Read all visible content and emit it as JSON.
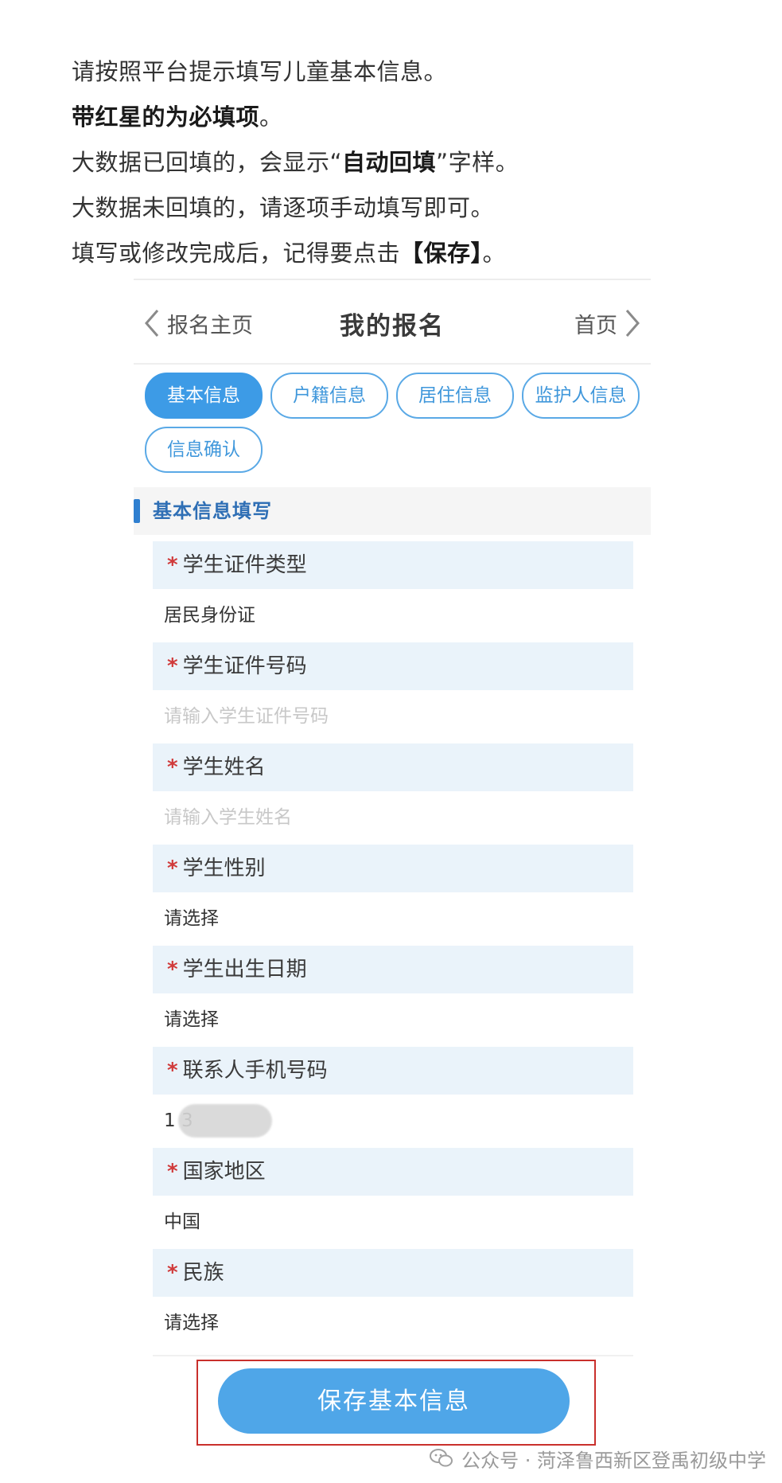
{
  "intro": {
    "line1": "请按照平台提示填写儿童基本信息。",
    "line2_bold": "带红星的为必填项",
    "line2_end": "。",
    "line3_start": "大数据已回填的，会显示“",
    "line3_bold": "自动回填",
    "line3_end": "”字样。",
    "line4": "大数据未回填的，请逐项手动填写即可。",
    "line5_start": "填写或修改完成后，记得要点击",
    "line5_bold": "【保存】",
    "line5_end": "。"
  },
  "nav": {
    "back_label": "报名主页",
    "title": "我的报名",
    "home_label": "首页"
  },
  "tabs": [
    {
      "label": "基本信息",
      "active": true
    },
    {
      "label": "户籍信息",
      "active": false
    },
    {
      "label": "居住信息",
      "active": false
    },
    {
      "label": "监护人信息",
      "active": false
    },
    {
      "label": "信息确认",
      "active": false
    }
  ],
  "section": {
    "title": "基本信息填写"
  },
  "fields": [
    {
      "label": "学生证件类型",
      "value": "居民身份证",
      "placeholder": ""
    },
    {
      "label": "学生证件号码",
      "value": "",
      "placeholder": "请输入学生证件号码"
    },
    {
      "label": "学生姓名",
      "value": "",
      "placeholder": "请输入学生姓名"
    },
    {
      "label": "学生性别",
      "value": "请选择",
      "placeholder": ""
    },
    {
      "label": "学生出生日期",
      "value": "请选择",
      "placeholder": ""
    },
    {
      "label": "联系人手机号码",
      "value": "1          3",
      "placeholder": ""
    },
    {
      "label": "国家地区",
      "value": "中国",
      "placeholder": ""
    },
    {
      "label": "民族",
      "value": "请选择",
      "placeholder": ""
    }
  ],
  "required_mark": "*",
  "save_button": {
    "label": "保存基本信息"
  },
  "watermark": {
    "text": "公众号 · 菏泽鲁西新区登禹初级中学"
  },
  "colors": {
    "accent": "#3d9be6",
    "required": "#d03a3a",
    "label_bg": "#eaf3fa",
    "highlight_frame": "#c9302c"
  }
}
